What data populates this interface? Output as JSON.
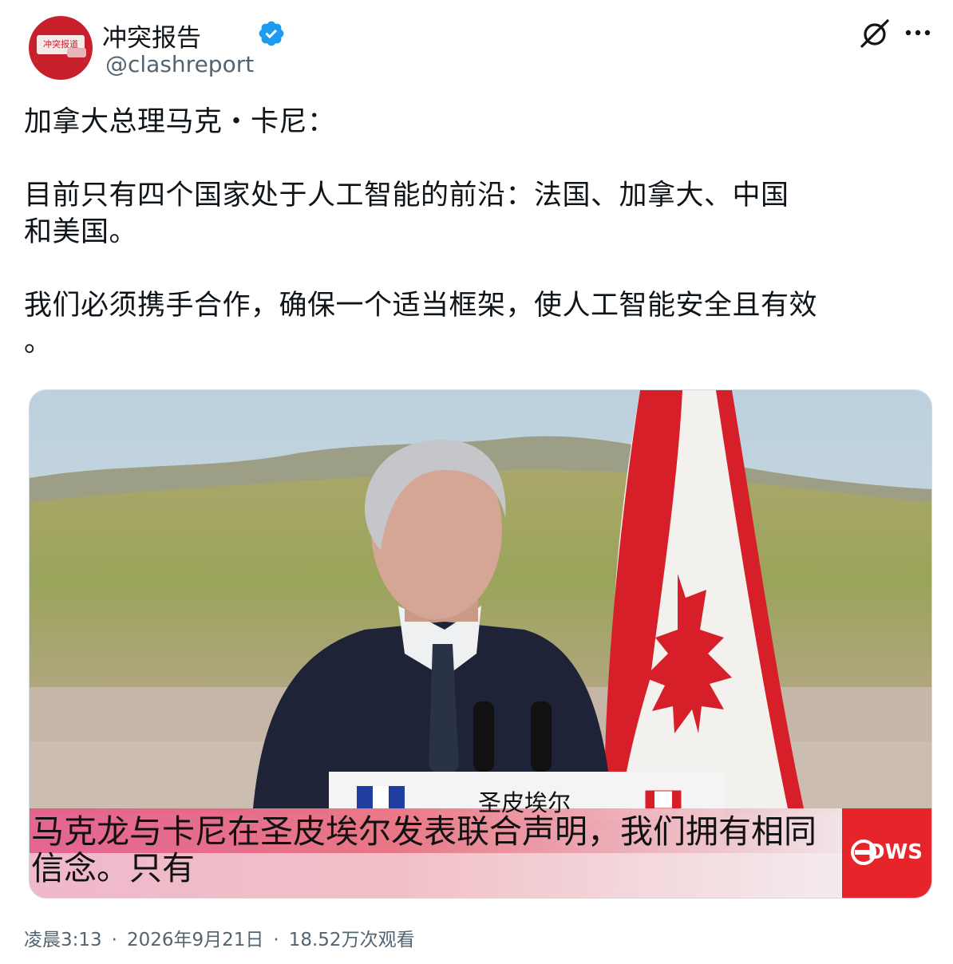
{
  "account": {
    "display_name": "冲突报告",
    "handle": "@clashreport",
    "avatar_text": "冲突报道",
    "verified": true
  },
  "post": {
    "text": "加拿大总理马克・卡尼：\n\n目前只有四个国家处于人工智能的前沿：法国、加拿大、中国\n和美国。\n\n我们必须携手合作，确保一个适当框架，使人工智能安全且有效\n。"
  },
  "media": {
    "podium_label": "圣皮埃尔",
    "subtitle": "马克龙与卡尼在圣皮埃尔发表联合声明，我们拥有相同\n信念。只有",
    "brand": "DWS",
    "brand_color": "#e8242b"
  },
  "meta": {
    "time": "凌晨3:13",
    "date": "2026年9月21日",
    "views": "18.52万次观看"
  },
  "icons": {
    "verified": "verified-badge-icon",
    "grok": "grok-icon",
    "more": "more-options-icon"
  },
  "colors": {
    "verified_blue": "#1d9bf0",
    "secondary_text": "#536471",
    "avatar_red": "#c8202c"
  }
}
